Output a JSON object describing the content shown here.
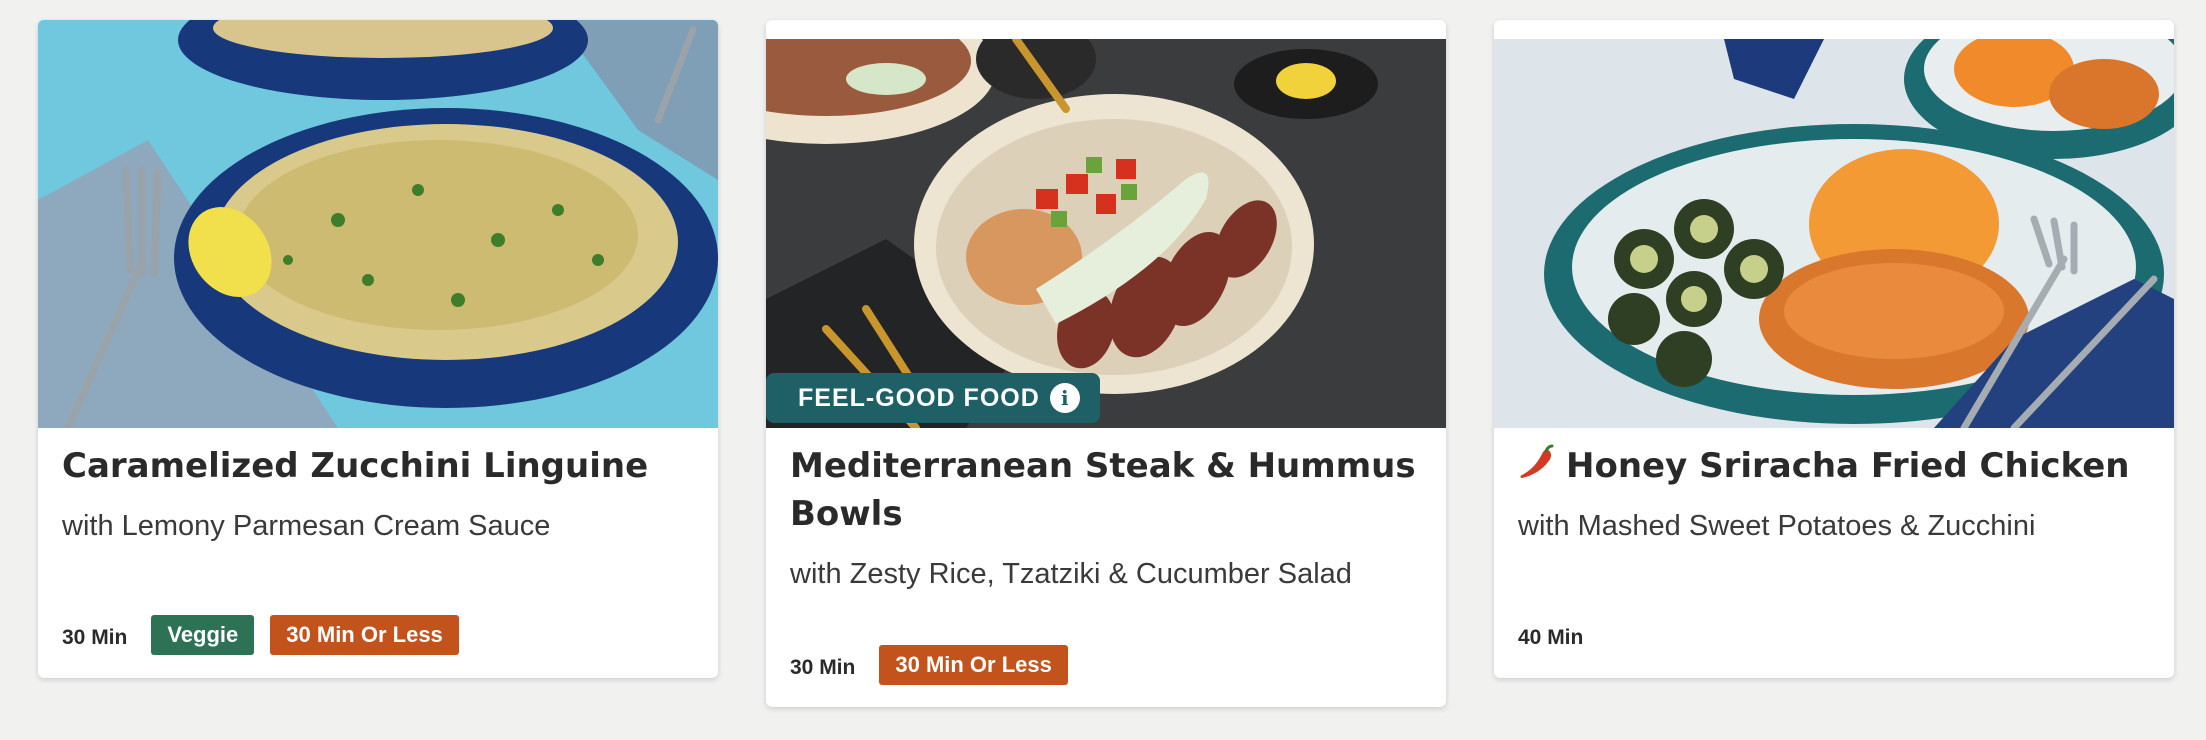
{
  "colors": {
    "page_background": "#f1f1f0",
    "feel_good_badge": "#1f5f66",
    "veggie_tag": "#2e7255",
    "quick_tag": "#c2531c",
    "spicy_icon": "#d33a24"
  },
  "recipes": [
    {
      "title": "Caramelized Zucchini Linguine",
      "subtitle": "with Lemony Parmesan Cream Sauce",
      "time": "30 Min",
      "tags": [
        "Veggie",
        "30 Min Or Less"
      ],
      "image": "linguine-bowl-photo"
    },
    {
      "badge": "FEEL-GOOD FOOD",
      "badge_icon": "info-icon",
      "title": "Mediterranean Steak & Hummus Bowls",
      "subtitle": "with Zesty Rice, Tzatziki & Cucumber Salad",
      "time": "30 Min",
      "tags": [
        "30 Min Or Less"
      ],
      "image": "steak-hummus-bowl-photo"
    },
    {
      "title_icon": "spicy-pepper-icon",
      "title": "Honey Sriracha Fried Chicken",
      "subtitle": "with Mashed Sweet Potatoes & Zucchini",
      "time": "40 Min",
      "tags": [],
      "image": "fried-chicken-plate-photo"
    }
  ]
}
